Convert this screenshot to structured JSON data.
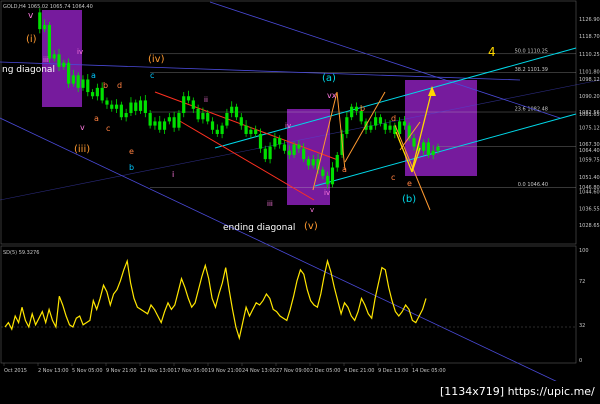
{
  "chart_data": [
    {
      "type": "candlestick",
      "symbol_header": "GOLD,H4  1065.02 1065.74 1064.40",
      "price_axis_ticks": [
        "1126.90",
        "1118.70",
        "1110.25",
        "1101.80",
        "1098.12",
        "1090.20",
        "1082.56",
        "1081.65",
        "1075.12",
        "1067.30",
        "1064.40",
        "1059.75",
        "1051.40",
        "1046.80",
        "1044.60",
        "1036.55",
        "1028.65"
      ],
      "fib_levels": [
        {
          "label": "50.0  1110.25",
          "price": 1110.25
        },
        {
          "label": "38.2  1101.39",
          "price": 1101.39
        },
        {
          "label": "23.6  1082.48",
          "price": 1082.48
        },
        {
          "label": "0.0  1046.40",
          "price": 1046.4
        }
      ],
      "ylim": [
        1020,
        1134
      ],
      "time_axis_labels": [
        "Oct 2015",
        "2 Nov 13:00",
        "5 Nov 05:00",
        "9 Nov 21:00",
        "12 Nov 13:00",
        "17 Nov 05:00",
        "19 Nov 21:00",
        "24 Nov 13:00",
        "27 Nov 09:00",
        "2 Dec 05:00",
        "4 Dec 21:00",
        "9 Dec 13:00",
        "14 Dec 05:00"
      ],
      "close_path": [
        1130,
        1122,
        1124,
        1108,
        1110,
        1104,
        1106,
        1096,
        1100,
        1094,
        1098,
        1092,
        1090,
        1094,
        1088,
        1086,
        1084,
        1086,
        1080,
        1082,
        1087,
        1083,
        1088,
        1082,
        1076,
        1078,
        1074,
        1078,
        1080,
        1075,
        1082,
        1090,
        1088,
        1084,
        1079,
        1082,
        1078,
        1074,
        1072,
        1076,
        1082,
        1085,
        1080,
        1076,
        1072,
        1074,
        1072,
        1065,
        1060,
        1066,
        1070,
        1067,
        1064,
        1062,
        1067,
        1065,
        1060,
        1057,
        1060,
        1055,
        1052,
        1048,
        1056,
        1062,
        1072,
        1080,
        1085,
        1083,
        1078,
        1074,
        1076,
        1080,
        1077,
        1074,
        1076,
        1072,
        1078,
        1076,
        1070,
        1066,
        1064,
        1068,
        1062,
        1064,
        1066
      ]
    },
    {
      "type": "line",
      "indicator_label": "SD(5) 59.3276",
      "y_ticks": [
        "100",
        "72",
        "32",
        "0"
      ],
      "ylim": [
        0,
        100
      ],
      "values": [
        30,
        34,
        28,
        40,
        34,
        48,
        36,
        30,
        42,
        32,
        38,
        44,
        34,
        46,
        36,
        30,
        58,
        50,
        40,
        32,
        30,
        38,
        40,
        32,
        34,
        36,
        54,
        46,
        56,
        68,
        62,
        50,
        60,
        64,
        72,
        82,
        90,
        70,
        56,
        48,
        46,
        44,
        42,
        50,
        46,
        40,
        34,
        44,
        52,
        46,
        50,
        62,
        74,
        66,
        56,
        48,
        52,
        64,
        76,
        86,
        74,
        56,
        48,
        60,
        70,
        84,
        64,
        46,
        30,
        20,
        34,
        48,
        40,
        46,
        52,
        50,
        54,
        60,
        56,
        46,
        44,
        40,
        38,
        36,
        46,
        58,
        72,
        82,
        78,
        64,
        54,
        50,
        48,
        60,
        76,
        90,
        80,
        66,
        54,
        42,
        52,
        48,
        40,
        36,
        44,
        56,
        50,
        42,
        38,
        56,
        70,
        84,
        82,
        66,
        54,
        44,
        40,
        44,
        50,
        46,
        36,
        34,
        40,
        46,
        56
      ]
    }
  ],
  "wave_labels": {
    "v_top": "v",
    "i_paren": "(i)",
    "iii_top": "iii",
    "iv_top": "iv",
    "a_left": "a",
    "b_left": "b",
    "d_left": "d",
    "c_left": "c",
    "iv_paren": "(iv)",
    "c_mid": "c",
    "v_left": "v",
    "a_left2": "a",
    "c_left2": "c",
    "iii_paren": "(iii)",
    "e_left": "e",
    "b_left2": "b",
    "ii_mid": "ii",
    "i_mid": "i",
    "iii_mid": "iii",
    "iv_right": "iv",
    "iv_small": "iv",
    "v_bottom": "v",
    "v_paren": "(v)",
    "a_paren": "(a)",
    "vx": "vx",
    "b_right": "b",
    "a_right": "a",
    "d_right": "d",
    "c_right": "c",
    "e_right": "e",
    "b_paren": "(b)",
    "four": "4"
  },
  "annotations": {
    "ending_diagonal": "ending diagonal",
    "ng_diagonal": "ng diagonal"
  },
  "watermark": "[1134x719] https://upic.me/"
}
